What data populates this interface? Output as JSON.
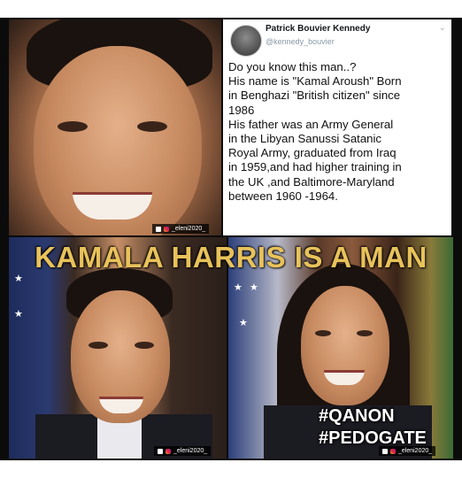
{
  "tweet": {
    "author_name": "Patrick Bouvier Kennedy",
    "author_handle": "@kennedy_bouvier",
    "lines": [
      "Do you know this man..?",
      "His name is \"Kamal Aroush\" Born",
      "in Benghazi \"British citizen\" since",
      "1986",
      "His father was an Army General",
      "in the Libyan Sanussi Satanic",
      "Royal Army, graduated from Iraq",
      "in 1959,and had higher training in",
      "the UK ,and Baltimore-Maryland",
      "between 1960 -1964."
    ]
  },
  "headline": "KAMALA HARRIS IS A MAN",
  "hashtags": [
    "#QANON",
    "#PEDOGATE"
  ],
  "watermark": "_eleni2020_",
  "colors": {
    "headline": "#e8c25a",
    "hashtags": "#ffffff",
    "background": "#0b0b0b"
  }
}
